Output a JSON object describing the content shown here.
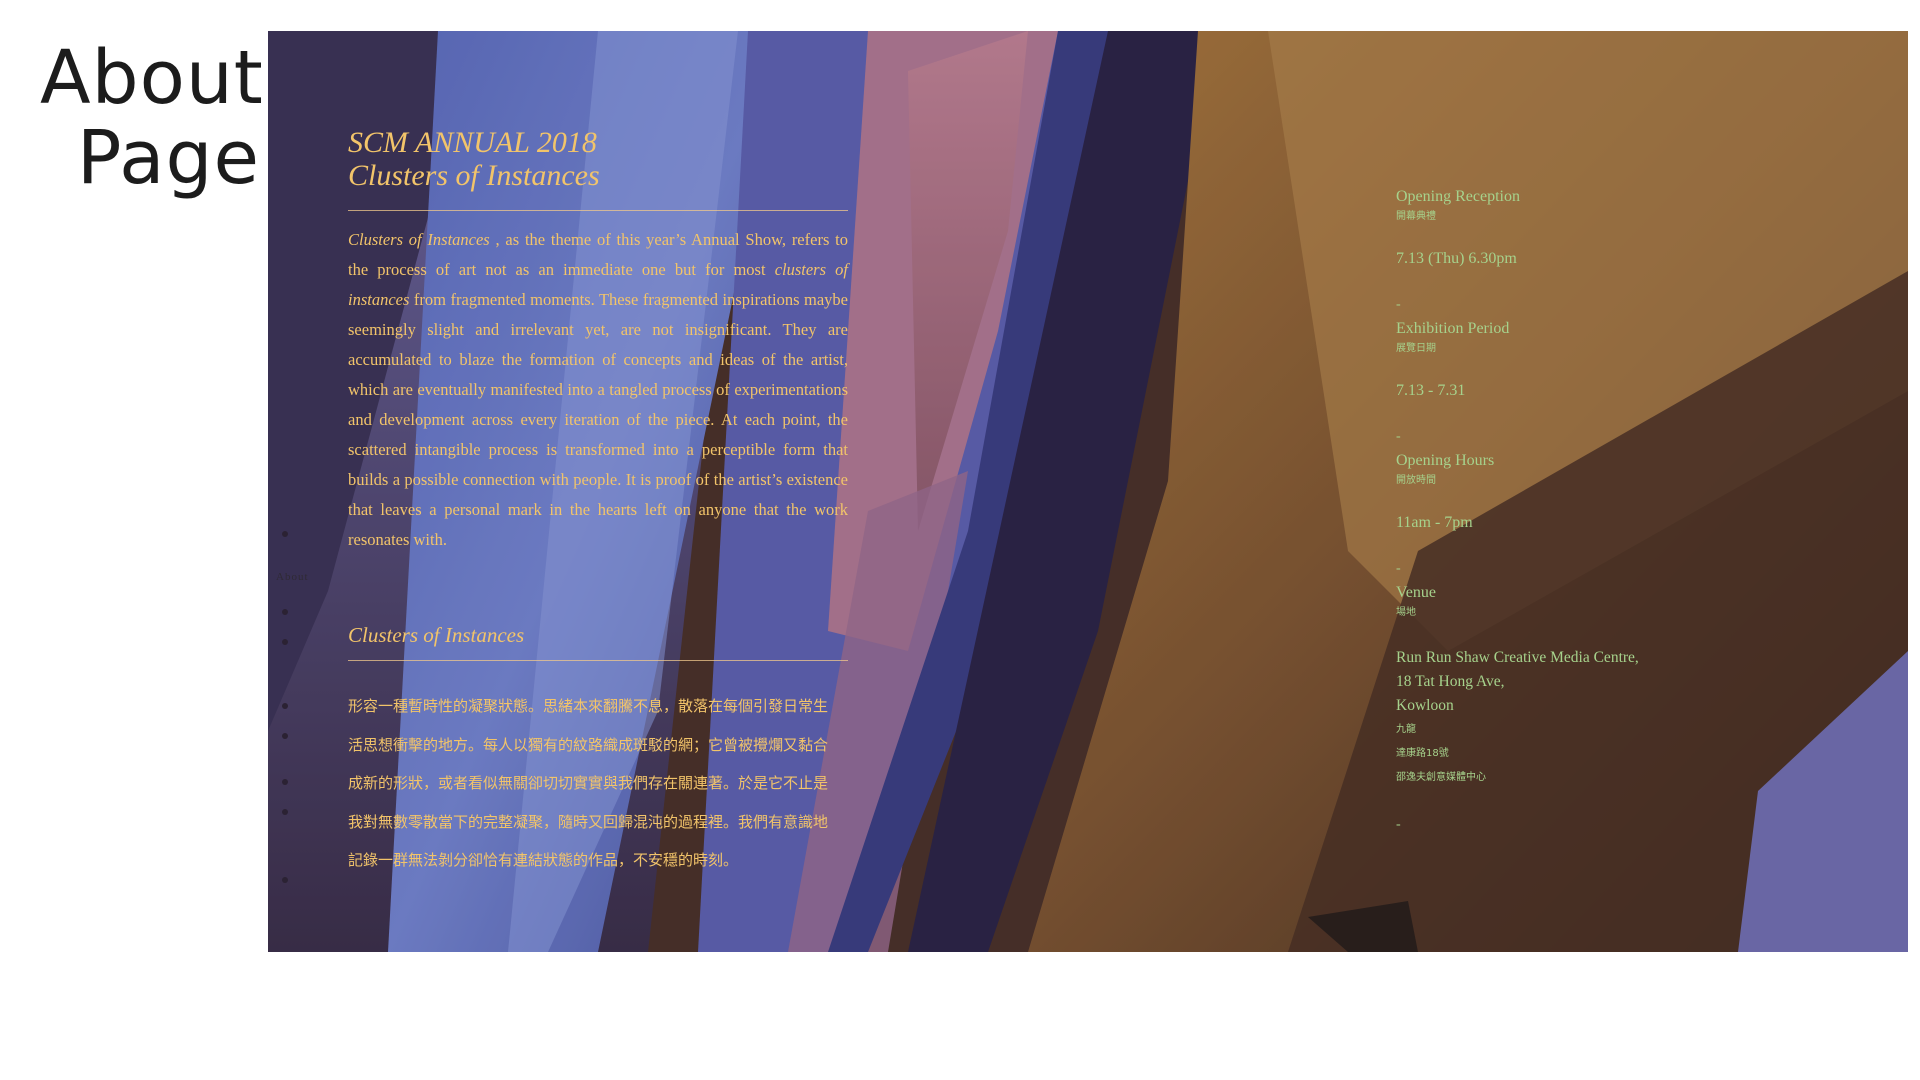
{
  "page_label": {
    "line1": "About",
    "line2": "Page"
  },
  "hero": {
    "annual_title_line1": "SCM ANNUAL 2018",
    "annual_title_line2": "Clusters of Instances",
    "intro": {
      "lead_em": "Clusters of Instances",
      "part1": " , as the theme of this year’s Annual Show, refers to the process of art not as an immediate one but for most ",
      "em2": "clusters of instances",
      "part2": " from fragmented moments. These fragmented inspirations maybe seemingly slight and irrelevant yet, are not insignificant. They are accumulated to blaze the formation of concepts and ideas of the artist, which are eventually manifested into a tangled process of experimentations and development across every iteration of the piece. At each point, the scattered intangible process is transformed into a perceptible form that builds a possible connection with people. It is proof of the artist’s existence that leaves a personal mark in the hearts left on anyone that the work resonates with."
    },
    "subtitle": "Clusters of Instances",
    "zh_lines": [
      "形容一種暫時性的凝聚狀態。思緒本來翻騰不息，散落在每個引發日常生",
      "活思想衝擊的地方。每人以獨有的紋路織成斑駁的網；它曾被攪爛又黏合",
      "成新的形狀，或者看似無關卻切切實實與我們存在關連著。於是它不止是",
      "我對無數零散當下的完整凝聚，隨時又回歸混沌的過程裡。我們有意識地",
      "記錄一群無法剝分卻恰有連結狀態的作品，不安穩的時刻。"
    ],
    "side_nav_label": "About"
  },
  "info": {
    "reception_label": "Opening Reception",
    "reception_zh": "開幕典禮",
    "reception_value": "7.13 (Thu) 6.30pm",
    "dash": "-",
    "period_label": "Exhibition Period",
    "period_zh": "展覽日期",
    "period_value": "7.13 - 7.31",
    "hours_label": "Opening Hours",
    "hours_zh": "開放時間",
    "hours_value": "11am - 7pm",
    "venue_label": "Venue",
    "venue_zh": "場地",
    "venue_en_1": "Run Run Shaw Creative Media Centre,",
    "venue_en_2": "18 Tat Hong Ave,",
    "venue_en_3": "Kowloon",
    "venue_zh_1": "九龍",
    "venue_zh_2": "達康路18號",
    "venue_zh_3": "邵逸夫創意媒體中心"
  },
  "colors": {
    "heading_gold": "#f2c46a",
    "info_green": "#a6d28c"
  }
}
